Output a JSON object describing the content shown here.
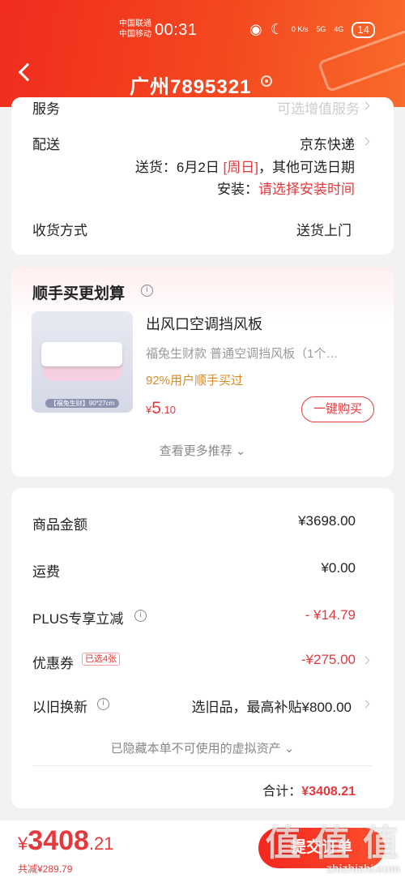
{
  "status_bar": {
    "carrier1": "中国联通",
    "carrier2": "中国移动",
    "time": "00:31",
    "net_speed": "0 K/s",
    "signal1": "5G",
    "signal2": "4G",
    "battery": "14"
  },
  "header": {
    "address": "广州7895321"
  },
  "delivery": {
    "service_label": "服务",
    "service_value": "可选增值服务",
    "shipping_label": "配送",
    "shipping_value": "京东快递",
    "delivery_prefix": "送货：",
    "delivery_date": "6月2日",
    "delivery_day": "[周日]",
    "delivery_suffix": "，其他可选日期",
    "install_prefix": "安装：",
    "install_value": "请选择安装时间",
    "receive_label": "收货方式",
    "receive_value": "送货上门"
  },
  "addon": {
    "title": "顺手买更划算",
    "product_name": "出风口空调挡风板",
    "product_desc": "福兔生财款  普通空调挡风板（1个…",
    "rate": "92%用户顺手买过",
    "currency": "¥",
    "price_int": "5",
    "price_dec": ".10",
    "buy_button": "一键购买",
    "image_caption": "【福兔生财】90*27cm",
    "more": "查看更多推荐"
  },
  "summary": {
    "goods_label": "商品金额",
    "goods_value": "¥3698.00",
    "freight_label": "运费",
    "freight_value": "¥0.00",
    "plus_label": "PLUS专享立减",
    "plus_value": "- ¥14.79",
    "coupon_label": "优惠券",
    "coupon_badge": "已选4张",
    "coupon_value": "-¥275.00",
    "tradein_label": "以旧换新",
    "tradein_value": "选旧品，最高补贴¥800.00",
    "hidden_note": "已隐藏本单不可使用的虚拟资产",
    "total_label": "合计：",
    "total_value": "¥3408.21"
  },
  "bottom_bar": {
    "currency": "¥",
    "total_int": "3408",
    "total_dec": ".21",
    "saved": "共减¥289.79",
    "submit": "提交订单",
    "watermark": "值 值 值",
    "watermark_site": "zhizhizhi.com"
  }
}
